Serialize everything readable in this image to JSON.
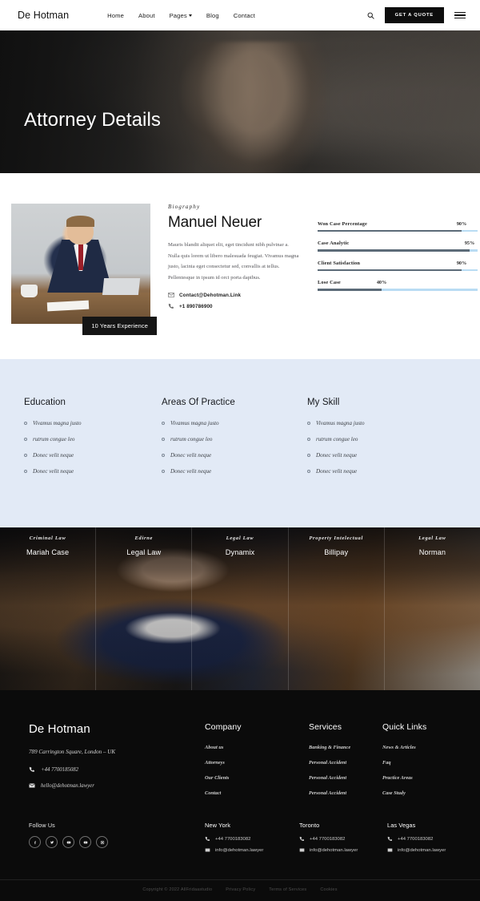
{
  "header": {
    "brand": "De Hotman",
    "nav": [
      {
        "label": "Home",
        "has_dropdown": false
      },
      {
        "label": "About",
        "has_dropdown": false
      },
      {
        "label": "Pages",
        "has_dropdown": true
      },
      {
        "label": "Blog",
        "has_dropdown": false
      },
      {
        "label": "Contact",
        "has_dropdown": false
      }
    ],
    "search_icon": "search-icon",
    "quote_button": "GET A QUOTE",
    "menu_icon": "hamburger-icon"
  },
  "hero": {
    "title": "Attorney Details"
  },
  "bio": {
    "experience_badge": "10 Years Experience",
    "label": "Biography",
    "name": "Manuel Neuer",
    "paragraph": "Mauris blandit aliquet elit, eget tincidunt nibh pulvinar a. Nulla quis lorem ut libero malesuada feugiat. Vivamus magna justo, lacinia eget consectetur sed, convallis at tellus. Pellentesque in ipsum id orci porta dapibus.",
    "email": "Contact@Dehotman.Link",
    "phone": "+1 890786900"
  },
  "skills_chart": {
    "type": "bar",
    "orientation": "horizontal",
    "categories": [
      "Won Case Percentage",
      "Case Analytic",
      "Client Satisfaction",
      "Lose Case"
    ],
    "values": [
      90,
      95,
      90,
      40
    ],
    "labels": [
      "90%",
      "95%",
      "90%",
      "40%"
    ],
    "max": 100,
    "fill_color": "#5c6b78",
    "track_color": "#b9dcf3"
  },
  "columns": [
    {
      "title": "Education",
      "items": [
        "Vivamus magna justo",
        "rutrum congue leo",
        "Donec velit neque",
        "Donec velit neque"
      ]
    },
    {
      "title": "Areas Of Practice",
      "items": [
        "Vivamus magna justo",
        "rutrum congue leo",
        "Donec velit neque",
        "Donec velit neque"
      ]
    },
    {
      "title": "My Skill",
      "items": [
        "Vivamus magna justo",
        "rutrum congue leo",
        "Donec velit neque",
        "Donec velit neque"
      ]
    }
  ],
  "team": [
    {
      "role": "Criminal Law",
      "name": "Mariah Case"
    },
    {
      "role": "Edirne",
      "name": "Legal Law"
    },
    {
      "role": "Legal Law",
      "name": "Dynamix"
    },
    {
      "role": "Property Intelectual",
      "name": "Billipay"
    },
    {
      "role": "Legal Law",
      "name": "Norman"
    }
  ],
  "footer": {
    "brand": "De Hotman",
    "address": "789 Carrington Square, London – UK",
    "phone": "+44 7700185082",
    "email": "hello@dehotman.lawyer",
    "link_columns": [
      {
        "title": "Company",
        "links": [
          "About us",
          "Attorneys",
          "Our Clients",
          "Contact"
        ]
      },
      {
        "title": "Services",
        "links": [
          "Banking & Finance",
          "Personal Accident",
          "Personal Accident",
          "Personal Accident"
        ]
      },
      {
        "title": "Quick Links",
        "links": [
          "News & Articles",
          "Faq",
          "Practice Areas",
          "Case Study"
        ]
      }
    ],
    "follow_title": "Follow Us",
    "socials": [
      "facebook-icon",
      "twitter-icon",
      "youtube-icon",
      "youtube-icon",
      "instagram-icon"
    ],
    "offices": [
      {
        "city": "New York",
        "phone": "+44 7700183082",
        "email": "info@dehotman.lawyer"
      },
      {
        "city": "Toronto",
        "phone": "+44 7700183082",
        "email": "info@dehotman.lawyer"
      },
      {
        "city": "Las Vegas",
        "phone": "+44 7700183082",
        "email": "info@dehotman.lawyer"
      }
    ],
    "copyright": "Copyright © 2022 AllFridaastudio",
    "legal_links": [
      "Privacy Policy",
      "Terms of Services",
      "Cookies"
    ]
  }
}
